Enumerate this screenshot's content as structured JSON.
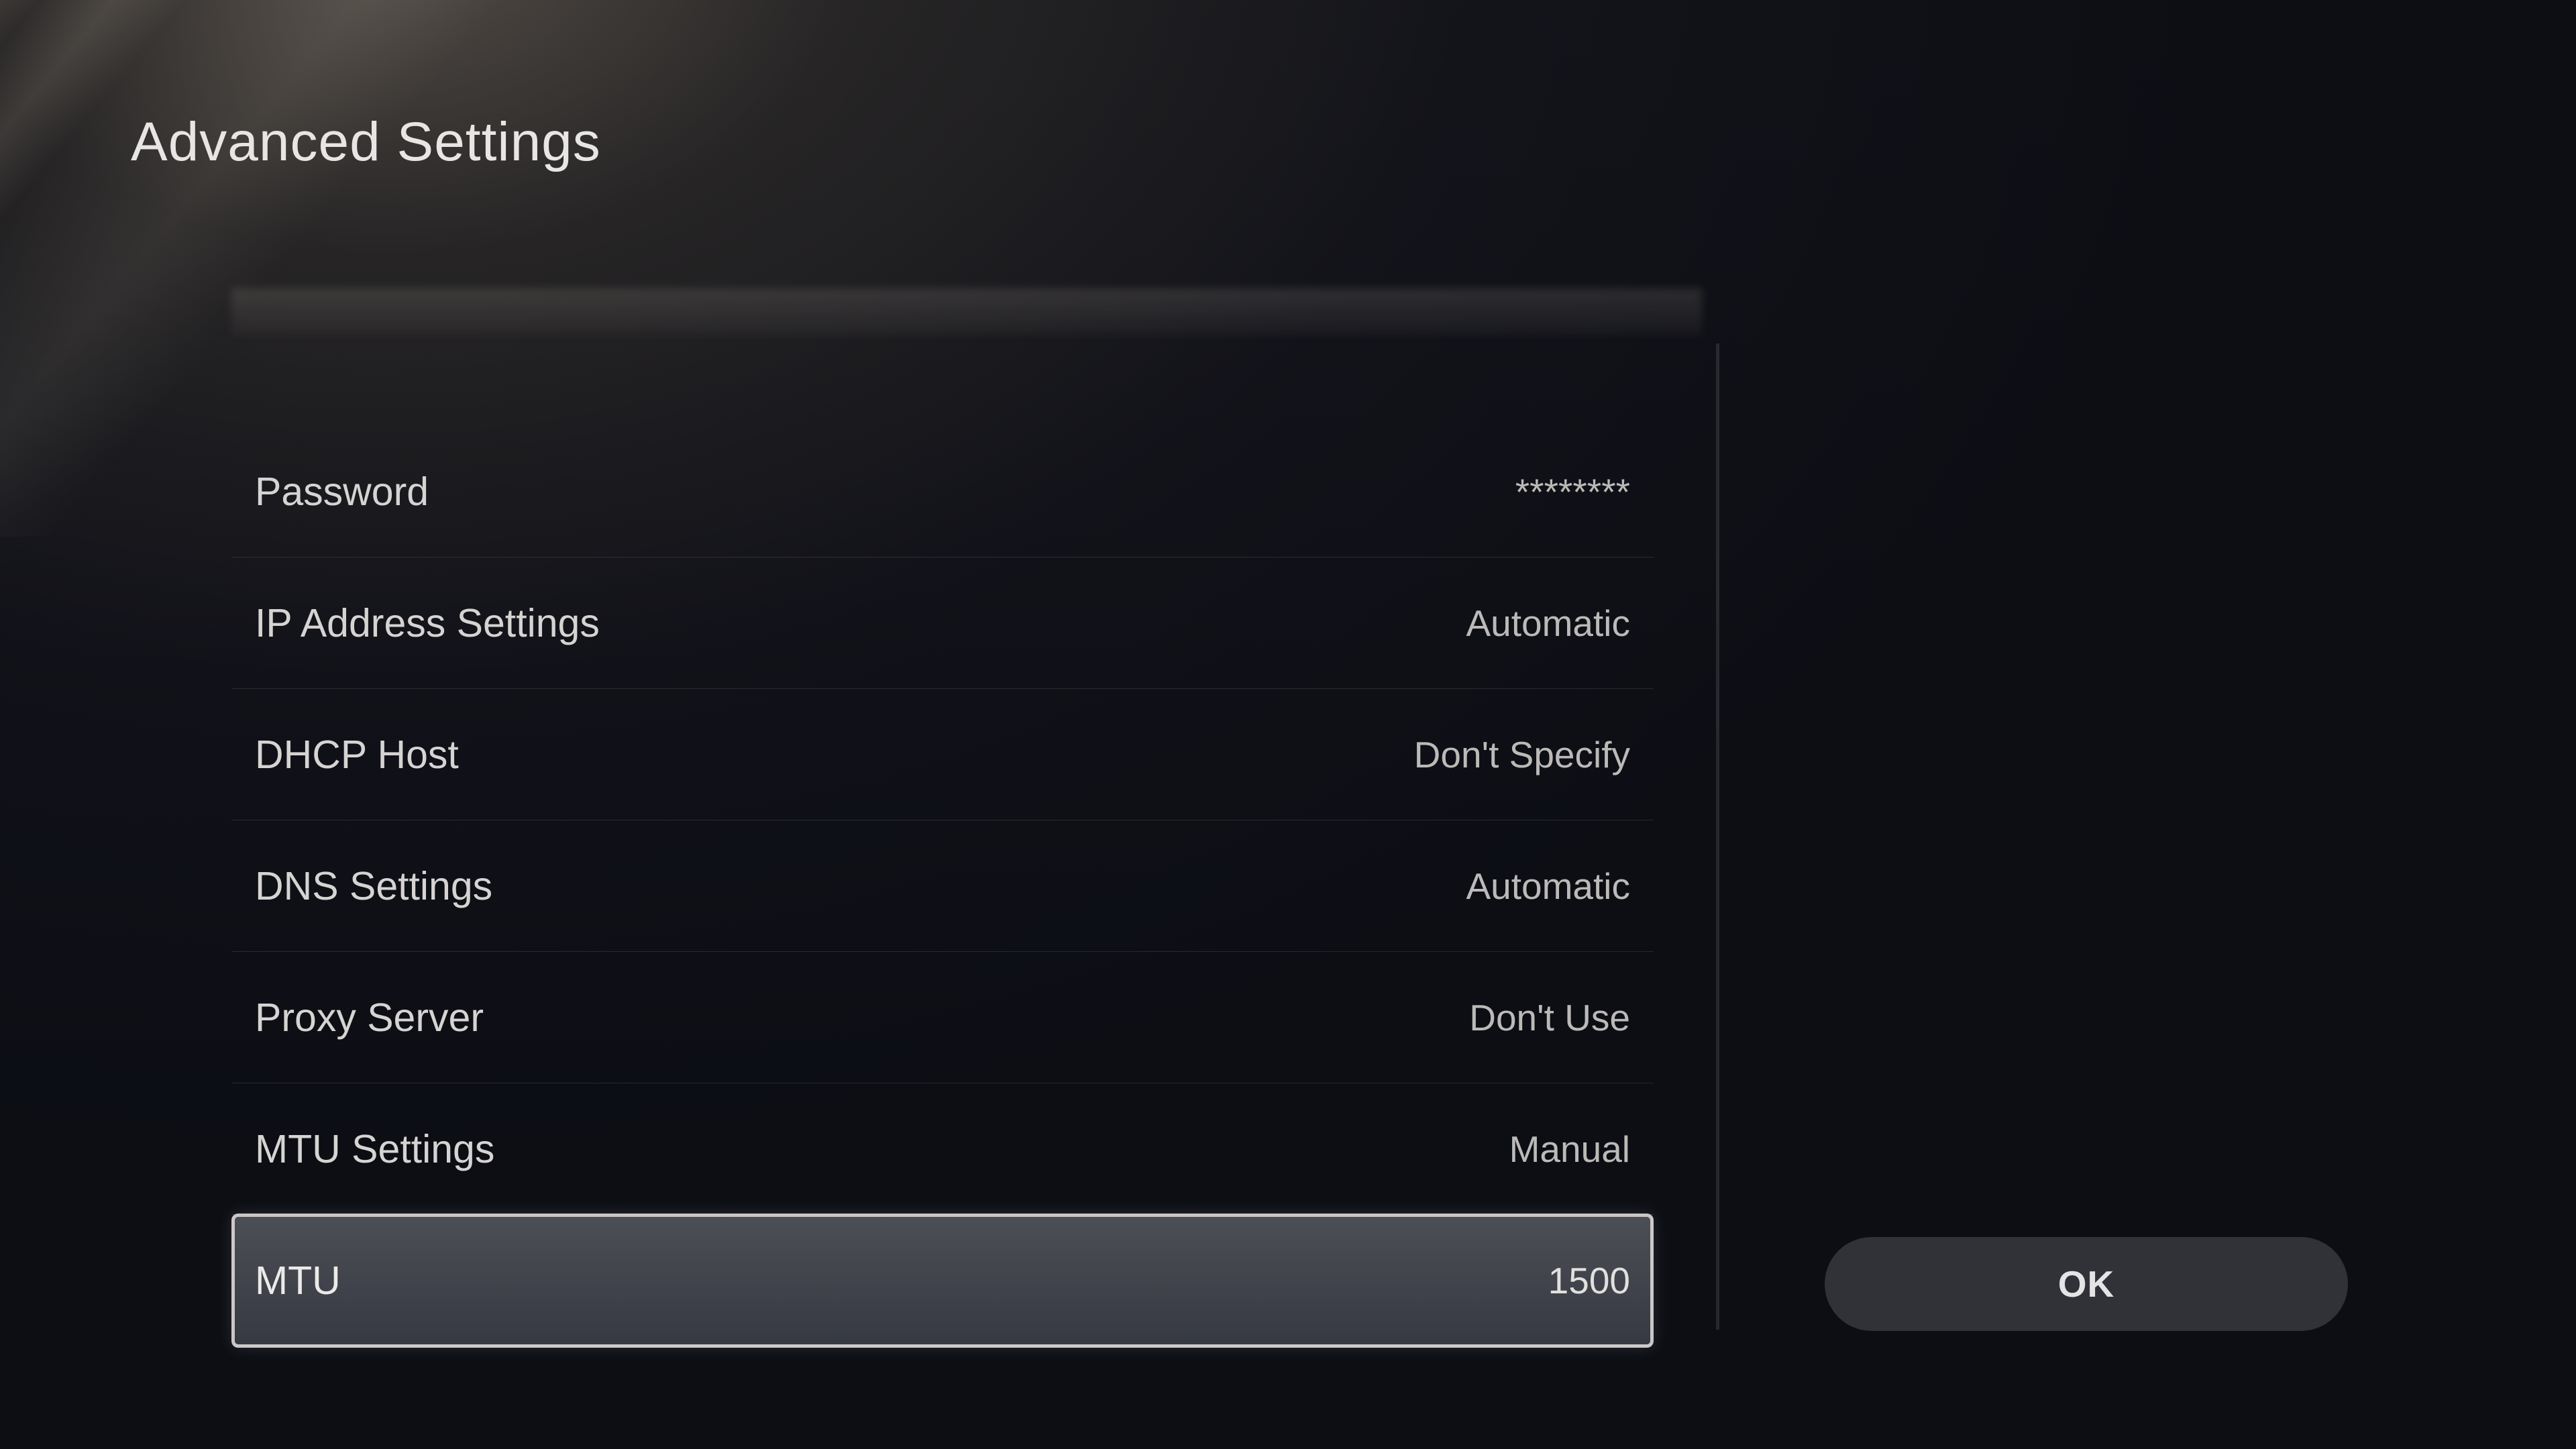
{
  "page": {
    "title": "Advanced Settings"
  },
  "settings": {
    "rows": [
      {
        "label": "Password",
        "value": "********"
      },
      {
        "label": "IP Address Settings",
        "value": "Automatic"
      },
      {
        "label": "DHCP Host",
        "value": "Don't Specify"
      },
      {
        "label": "DNS Settings",
        "value": "Automatic"
      },
      {
        "label": "Proxy Server",
        "value": "Don't Use"
      },
      {
        "label": "MTU Settings",
        "value": "Manual"
      },
      {
        "label": "MTU",
        "value": "1500"
      }
    ]
  },
  "actions": {
    "ok_label": "OK"
  }
}
